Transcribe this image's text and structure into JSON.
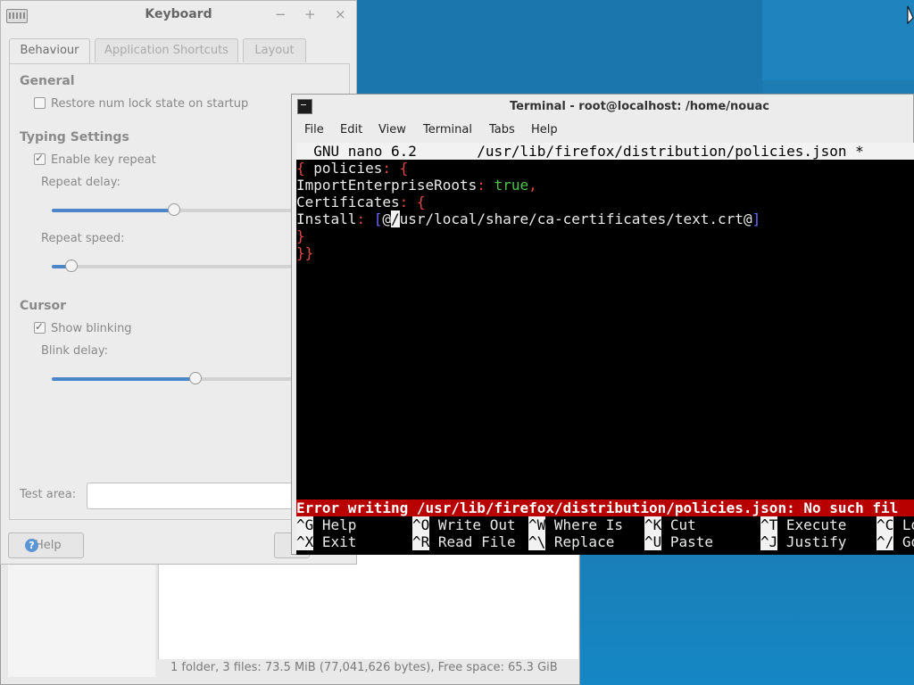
{
  "file_manager": {
    "status": "1 folder, 3 files: 73.5 MiB (77,041,626 bytes), Free space: 65.3 GiB"
  },
  "keyboard": {
    "title": "Keyboard",
    "window_buttons": [
      "−",
      "+",
      "×"
    ],
    "tabs": [
      "Behaviour",
      "Application Shortcuts",
      "Layout"
    ],
    "general_heading": "General",
    "numlock_label": "Restore num lock state on startup",
    "numlock_checked": false,
    "typing_heading": "Typing Settings",
    "key_repeat_label": "Enable key repeat",
    "key_repeat_checked": true,
    "repeat_delay_label": "Repeat delay:",
    "repeat_delay_level": 0.51,
    "repeat_speed_label": "Repeat speed:",
    "repeat_speed_level": 0.08,
    "cursor_heading": "Cursor",
    "blink_label": "Show blinking",
    "blink_checked": true,
    "blink_delay_label": "Blink delay:",
    "blink_delay_level": 0.6,
    "test_area_label": "Test area:",
    "help_label": "Help"
  },
  "terminal": {
    "title": "Terminal - root@localhost: /home/nouac",
    "menu": [
      "File",
      "Edit",
      "View",
      "Terminal",
      "Tabs",
      "Help"
    ],
    "nano_header": "  GNU nano 6.2       /usr/lib/firefox/distribution/policies.json *",
    "lines": {
      "l1_open": "{",
      "l1_key": " policies",
      "l1_rest": ": {",
      "l2_key": "ImportEnterpriseRoots",
      "l2_colon": ": ",
      "l2_val": "true",
      "l2_comma": ",",
      "l3_key": "Certificates",
      "l3_rest": ": {",
      "l4_key": "Install",
      "l4_colon": ": ",
      "l4_open": "[",
      "l4_at": "@",
      "l4_cursor": "/",
      "l4_path": "usr/local/share/ca-certificates/text.crt@",
      "l4_close": "]",
      "l5": "}",
      "l6": "}}"
    },
    "error": "Error writing /usr/lib/firefox/distribution/policies.json: No such fil",
    "shortcuts": [
      {
        "key": "^G",
        "label": " Help"
      },
      {
        "key": "^O",
        "label": " Write Out"
      },
      {
        "key": "^W",
        "label": " Where Is"
      },
      {
        "key": "^K",
        "label": " Cut"
      },
      {
        "key": "^T",
        "label": " Execute"
      },
      {
        "key": "^C",
        "label": " Lo"
      },
      {
        "key": "^X",
        "label": " Exit"
      },
      {
        "key": "^R",
        "label": " Read File"
      },
      {
        "key": "^\\",
        "label": " Replace"
      },
      {
        "key": "^U",
        "label": " Paste"
      },
      {
        "key": "^J",
        "label": " Justify"
      },
      {
        "key": "^/",
        "label": " Go"
      }
    ]
  }
}
